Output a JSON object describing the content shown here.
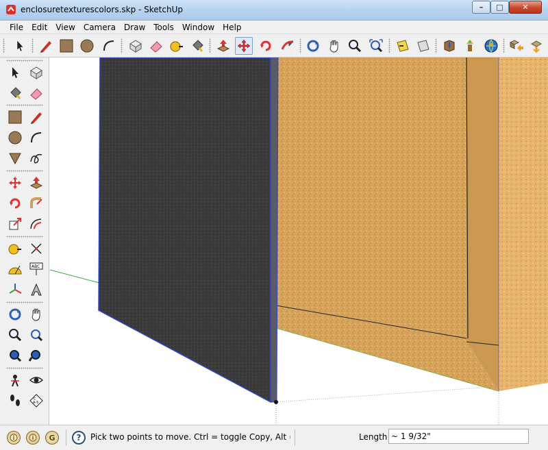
{
  "window": {
    "title": "enclosuretexturescolors.skp - SketchUp",
    "minimize_label": "–",
    "maximize_label": "□",
    "close_label": "✕"
  },
  "menu": [
    "File",
    "Edit",
    "View",
    "Camera",
    "Draw",
    "Tools",
    "Window",
    "Help"
  ],
  "top_toolbar": [
    "select",
    "pencil",
    "rectangle",
    "circle",
    "arc",
    "make-component",
    "eraser",
    "tape-measure",
    "paint-bucket",
    "push-pull",
    "move",
    "rotate",
    "follow-me",
    "orbit",
    "pan",
    "zoom",
    "zoom-extents",
    "previous-view",
    "next-view",
    "get-models",
    "share-model",
    "share-component",
    "3d-warehouse",
    "components",
    "extension"
  ],
  "left_toolbar": [
    "select",
    "make-component",
    "paint-bucket",
    "eraser",
    "rectangle",
    "line",
    "circle",
    "arc",
    "polygon",
    "freehand",
    "move",
    "push-pull",
    "rotate",
    "follow-me",
    "scale",
    "offset",
    "tape-measure",
    "dimension",
    "protractor",
    "text",
    "axes",
    "3d-text",
    "orbit",
    "pan",
    "zoom",
    "zoom-window",
    "zoom-extents",
    "previous",
    "position-camera",
    "look-around",
    "walk",
    "section-plane"
  ],
  "status": {
    "message": "Pick two points to move.  Ctrl = toggle Copy, Alt = toggle Auto-fold.",
    "vcb_label": "Length",
    "vcb_value": "~ 1 9/32\"",
    "status_icons": [
      "geo-location",
      "credits",
      "instructor"
    ]
  },
  "colors": {
    "panel_dark": "#3a3a3a",
    "panel_edge": "#2f44c8",
    "wood": "#d8a55a",
    "green_axis": "#3aa636"
  }
}
